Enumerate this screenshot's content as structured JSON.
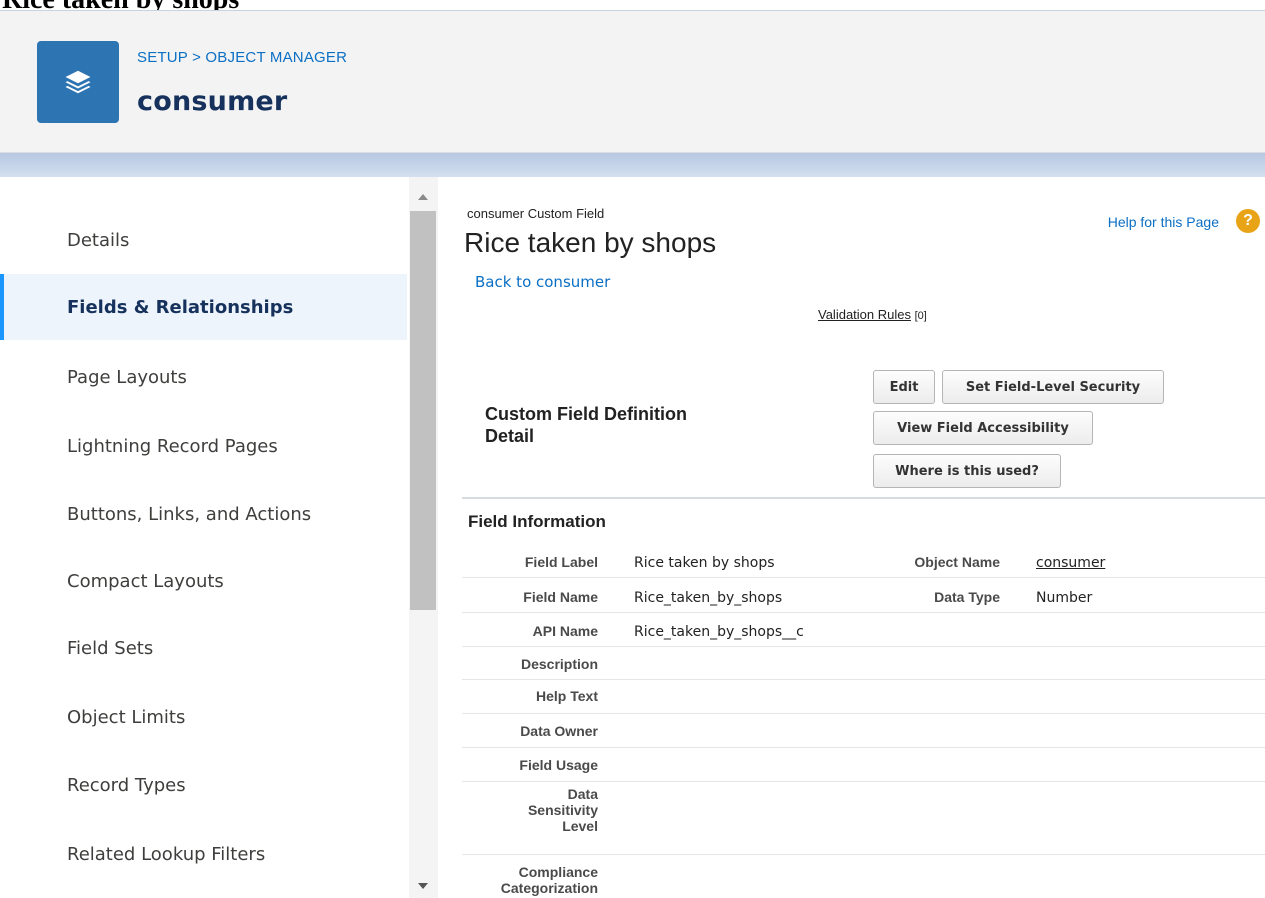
{
  "window_title": "Rice taken by shops",
  "header": {
    "breadcrumb": "SETUP > OBJECT MANAGER",
    "object_title": "consumer"
  },
  "sidebar": {
    "items": [
      {
        "label": "Details",
        "active": false
      },
      {
        "label": "Fields & Relationships",
        "active": true
      },
      {
        "label": "Page Layouts",
        "active": false
      },
      {
        "label": "Lightning Record Pages",
        "active": false
      },
      {
        "label": "Buttons, Links, and Actions",
        "active": false
      },
      {
        "label": "Compact Layouts",
        "active": false
      },
      {
        "label": "Field Sets",
        "active": false
      },
      {
        "label": "Object Limits",
        "active": false
      },
      {
        "label": "Record Types",
        "active": false
      },
      {
        "label": "Related Lookup Filters",
        "active": false
      }
    ]
  },
  "main": {
    "type_label": "consumer Custom Field",
    "title": "Rice taken by shops",
    "back_link": "Back to consumer",
    "help_link": "Help for this Page",
    "help_icon_glyph": "?",
    "validation_rules_label": "Validation Rules",
    "validation_rules_count": "[0]",
    "detail_heading_line1": "Custom Field Definition",
    "detail_heading_line2": "Detail",
    "buttons": {
      "edit": "Edit",
      "set_fls": "Set Field-Level Security",
      "view_access": "View Field Accessibility",
      "where_used": "Where is this used?"
    },
    "section_title": "Field Information",
    "fields": {
      "field_label": {
        "label": "Field Label",
        "value": "Rice taken by shops"
      },
      "object_name": {
        "label": "Object Name",
        "value": "consumer"
      },
      "field_name": {
        "label": "Field Name",
        "value": "Rice_taken_by_shops"
      },
      "data_type": {
        "label": "Data Type",
        "value": "Number"
      },
      "api_name": {
        "label": "API Name",
        "value": "Rice_taken_by_shops__c"
      },
      "description": {
        "label": "Description",
        "value": ""
      },
      "help_text": {
        "label": "Help Text",
        "value": ""
      },
      "data_owner": {
        "label": "Data Owner",
        "value": ""
      },
      "field_usage": {
        "label": "Field Usage",
        "value": ""
      },
      "data_sensitivity": {
        "label_l1": "Data",
        "label_l2": "Sensitivity",
        "label_l3": "Level",
        "value": ""
      },
      "compliance": {
        "label_l1": "Compliance",
        "label_l2": "Categorization",
        "value": ""
      }
    }
  },
  "colors": {
    "header_icon_bg": "#2d74b2",
    "link": "#0b6fc4",
    "active_nav_bg": "#eef4fb",
    "active_nav_border": "#1b96ff",
    "help_icon": "#e8a317"
  },
  "icons": {
    "header": "stacked-layers-icon",
    "help": "question-circle-icon",
    "scroll_up": "scroll-up-arrow-icon",
    "scroll_down": "scroll-down-arrow-icon"
  }
}
